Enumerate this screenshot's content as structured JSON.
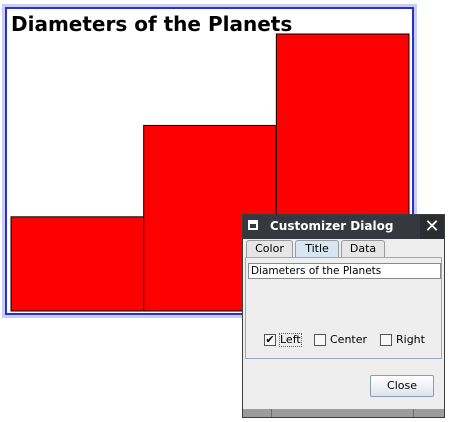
{
  "chart_data": {
    "type": "bar",
    "title": "Diameters of the Planets",
    "categories": [
      "",
      "",
      ""
    ],
    "values": [
      34,
      67,
      100
    ],
    "ylim": [
      0,
      100
    ],
    "bar_color": "#ff0000",
    "grid": false
  },
  "dialog": {
    "title": "Customizer Dialog",
    "close_glyph": "✕",
    "tabs": [
      "Color",
      "Title",
      "Data"
    ],
    "active_tab": "Title",
    "title_field_value": "Diameters of the Planets",
    "alignment_options": [
      {
        "label": "Left",
        "checked": true
      },
      {
        "label": "Center",
        "checked": false
      },
      {
        "label": "Right",
        "checked": false
      }
    ],
    "close_button_label": "Close"
  },
  "colors": {
    "frame_border": "#2a2fd0",
    "titlebar": "#36383f",
    "bar": "#ff0000"
  }
}
